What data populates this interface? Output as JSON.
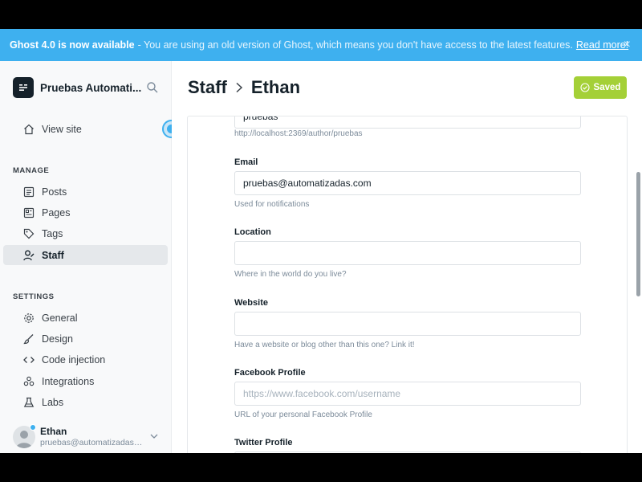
{
  "banner": {
    "title": "Ghost 4.0 is now available",
    "message": "- You are using an old version of Ghost, which means you don't have access to the latest features.",
    "link": "Read more!",
    "close_icon": "×"
  },
  "sidebar": {
    "site_title": "Pruebas Automati...",
    "view_site": "View site",
    "manage_label": "MANAGE",
    "manage_items": [
      {
        "label": "Posts",
        "icon": "posts-icon"
      },
      {
        "label": "Pages",
        "icon": "pages-icon"
      },
      {
        "label": "Tags",
        "icon": "tag-icon"
      },
      {
        "label": "Staff",
        "icon": "staff-icon",
        "active": true
      }
    ],
    "settings_label": "SETTINGS",
    "settings_items": [
      {
        "label": "General",
        "icon": "gear-icon"
      },
      {
        "label": "Design",
        "icon": "brush-icon"
      },
      {
        "label": "Code injection",
        "icon": "code-icon"
      },
      {
        "label": "Integrations",
        "icon": "integrations-icon"
      },
      {
        "label": "Labs",
        "icon": "flask-icon"
      }
    ],
    "user": {
      "name": "Ethan",
      "email": "pruebas@automatizadas.com"
    }
  },
  "header": {
    "breadcrumb_parent": "Staff",
    "breadcrumb_current": "Ethan",
    "saved_label": "Saved"
  },
  "form": {
    "slug": {
      "value": "pruebas",
      "help": "http://localhost:2369/author/pruebas"
    },
    "email": {
      "label": "Email",
      "value": "pruebas@automatizadas.com",
      "help": "Used for notifications"
    },
    "location": {
      "label": "Location",
      "value": "",
      "help": "Where in the world do you live?"
    },
    "website": {
      "label": "Website",
      "value": "",
      "help": "Have a website or blog other than this one? Link it!"
    },
    "facebook": {
      "label": "Facebook Profile",
      "placeholder": "https://www.facebook.com/username",
      "help": "URL of your personal Facebook Profile"
    },
    "twitter": {
      "label": "Twitter Profile"
    }
  },
  "colors": {
    "banner": "#3eb0ef",
    "saved_button": "#a4d037",
    "active_nav": "#e5e8eb"
  }
}
